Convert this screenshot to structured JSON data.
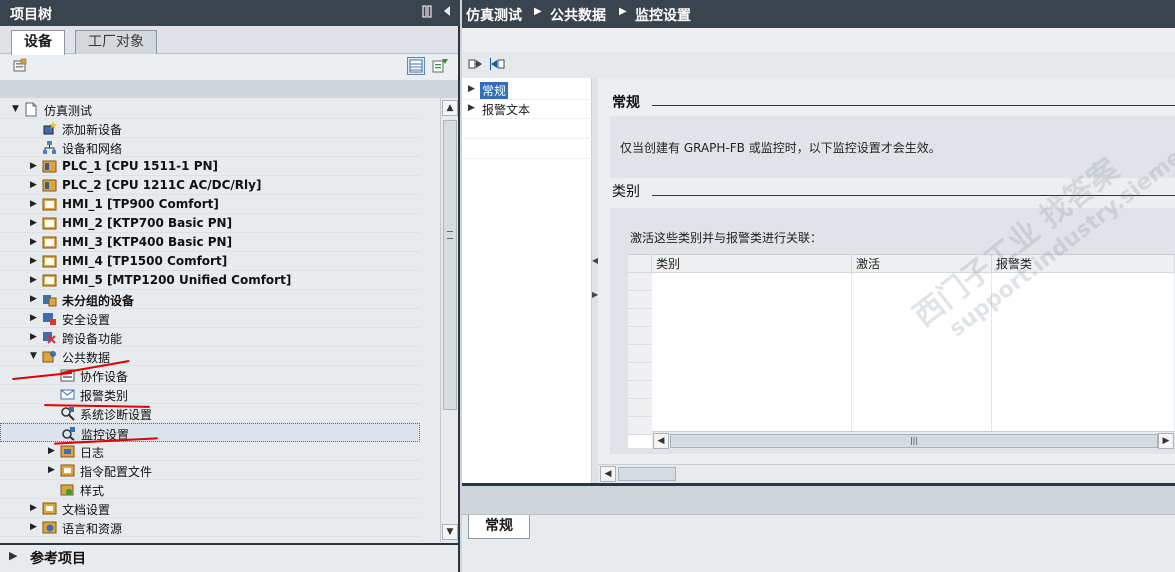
{
  "left_pane": {
    "title": "项目树",
    "tabs": [
      {
        "label": "设备",
        "active": true
      },
      {
        "label": "工厂对象",
        "active": false
      }
    ]
  },
  "tree": {
    "items": [
      {
        "label": "仿真测试",
        "icon": "project-icon",
        "expanded": true,
        "bold": false
      },
      {
        "label": "添加新设备",
        "icon": "add-device-icon",
        "bold": false
      },
      {
        "label": "设备和网络",
        "icon": "network-icon",
        "bold": false
      },
      {
        "label": "PLC_1 [CPU 1511-1 PN]",
        "icon": "plc-icon",
        "expanded": false,
        "bold": true
      },
      {
        "label": "PLC_2 [CPU 1211C AC/DC/Rly]",
        "icon": "plc-icon",
        "expanded": false,
        "bold": true
      },
      {
        "label": "HMI_1 [TP900 Comfort]",
        "icon": "hmi-icon",
        "expanded": false,
        "bold": true
      },
      {
        "label": "HMI_2 [KTP700 Basic PN]",
        "icon": "hmi-icon",
        "expanded": false,
        "bold": true
      },
      {
        "label": "HMI_3 [KTP400 Basic PN]",
        "icon": "hmi-icon",
        "expanded": false,
        "bold": true
      },
      {
        "label": "HMI_4 [TP1500 Comfort]",
        "icon": "hmi-icon",
        "expanded": false,
        "bold": true
      },
      {
        "label": "HMI_5 [MTP1200 Unified Comfort]",
        "icon": "hmi-icon",
        "expanded": false,
        "bold": true
      },
      {
        "label": "未分组的设备",
        "icon": "ungrouped-devices-icon",
        "expanded": false,
        "bold": true
      },
      {
        "label": "安全设置",
        "icon": "security-icon",
        "expanded": false,
        "bold": false
      },
      {
        "label": "跨设备功能",
        "icon": "cross-device-icon",
        "expanded": false,
        "bold": false
      },
      {
        "label": "公共数据",
        "icon": "common-data-icon",
        "expanded": true,
        "bold": false
      },
      {
        "label": "协作设备",
        "icon": "cooperation-device-icon",
        "bold": false
      },
      {
        "label": "报警类别",
        "icon": "alarm-classes-icon",
        "bold": false
      },
      {
        "label": "系统诊断设置",
        "icon": "diagnostics-icon",
        "bold": false
      },
      {
        "label": "监控设置",
        "icon": "supervision-icon",
        "bold": false,
        "selected": true
      },
      {
        "label": "日志",
        "icon": "log-icon",
        "expanded": false,
        "bold": false
      },
      {
        "label": "指令配置文件",
        "icon": "instruction-profile-icon",
        "expanded": false,
        "bold": false
      },
      {
        "label": "样式",
        "icon": "styles-icon",
        "bold": false
      },
      {
        "label": "文档设置",
        "icon": "doc-settings-icon",
        "expanded": false,
        "bold": false
      },
      {
        "label": "语言和资源",
        "icon": "language-icon",
        "expanded": false,
        "bold": false
      }
    ]
  },
  "reference_projects": {
    "label": "参考项目"
  },
  "breadcrumb": [
    "仿真测试",
    "公共数据",
    "监控设置"
  ],
  "nav": {
    "items": [
      {
        "label": "常规",
        "selected": true
      },
      {
        "label": "报警文本",
        "selected": false
      }
    ]
  },
  "content": {
    "general_title": "常规",
    "general_note": "仅当创建有 GRAPH-FB 或监控时，以下监控设置才会生效。",
    "category_title": "类别",
    "category_note": "激活这些类别并与报警类进行关联：",
    "table_headers": [
      "类别",
      "激活",
      "报警类"
    ]
  },
  "inspector": {
    "tab_label": "常规"
  },
  "watermark": {
    "line1": "西门子工业 找答案",
    "line2": "support.industry.siemens.com/cs"
  },
  "colors": {
    "titlebar": "#39444f",
    "selection": "#2f6fbf",
    "annotation": "#e00000"
  }
}
